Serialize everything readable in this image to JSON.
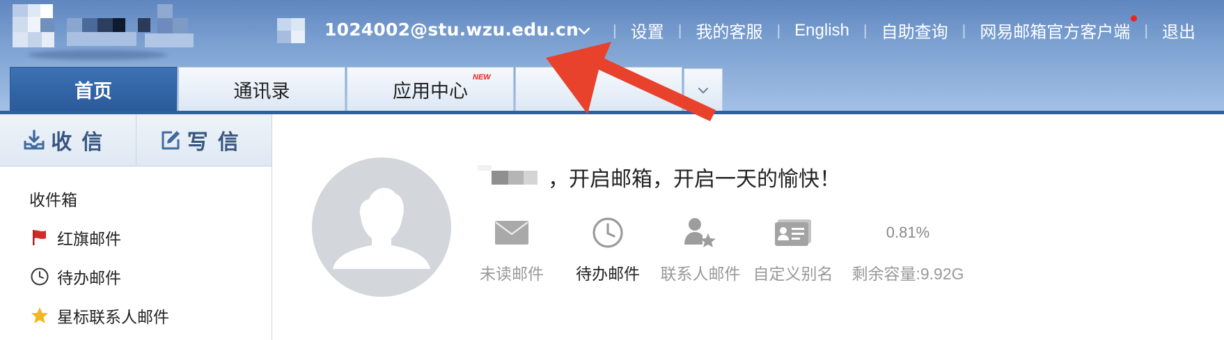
{
  "header": {
    "account_email": "1024002@stu.wzu.edu.cn",
    "nav": [
      {
        "label": "设置"
      },
      {
        "label": "我的客服"
      },
      {
        "label": "English"
      },
      {
        "label": "自助查询"
      },
      {
        "label": "网易邮箱官方客户端"
      },
      {
        "label": "退出"
      }
    ],
    "nav_separator": "|",
    "accent_color": "#2f5f9f",
    "notification_dot_color": "#e8261f"
  },
  "tabs": [
    {
      "label": "首页",
      "active": true
    },
    {
      "label": "通讯录",
      "active": false
    },
    {
      "label": "应用中心",
      "active": false,
      "badge": "NEW"
    },
    {
      "label": "",
      "active": false
    }
  ],
  "sidebar": {
    "receive_label": "收信",
    "compose_label": "写信",
    "folders": [
      {
        "label": "收件箱",
        "icon": ""
      },
      {
        "label": "红旗邮件",
        "icon": "red-flag-icon"
      },
      {
        "label": "待办邮件",
        "icon": "clock-icon"
      },
      {
        "label": "星标联系人邮件",
        "icon": "star-icon"
      }
    ]
  },
  "main": {
    "greeting": "，开启邮箱，开启一天的愉快！",
    "quick_links": [
      {
        "label": "未读邮件",
        "icon": "envelope-icon"
      },
      {
        "label": "待办邮件",
        "icon": "clock-icon"
      },
      {
        "label": "联系人邮件",
        "icon": "contact-star-icon"
      },
      {
        "label": "自定义别名",
        "icon": "id-card-icon"
      }
    ],
    "storage": {
      "used_percent": "0.81%",
      "remaining_label": "剩余容量:9.92G"
    }
  },
  "annotation": {
    "type": "red-arrow",
    "color": "#e8412c"
  }
}
